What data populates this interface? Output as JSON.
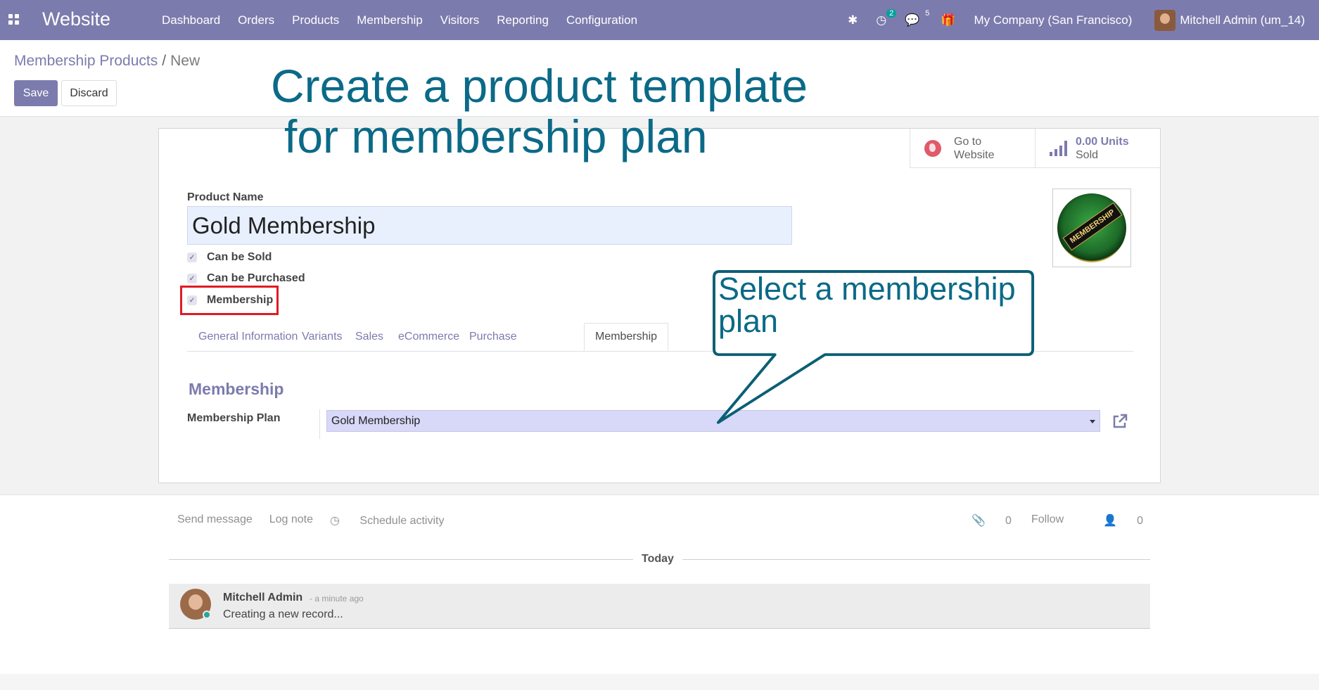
{
  "navbar": {
    "app_name": "Website",
    "menu": [
      "Dashboard",
      "Orders",
      "Products",
      "Membership",
      "Visitors",
      "Reporting",
      "Configuration"
    ],
    "activity_count": "2",
    "message_count": "5",
    "company": "My Company (San Francisco)",
    "user": "Mitchell Admin (um_14)"
  },
  "breadcrumb": {
    "parent": "Membership Products",
    "separator": "/",
    "current": "New"
  },
  "buttons": {
    "save": "Save",
    "discard": "Discard"
  },
  "smart_buttons": {
    "website": {
      "line1": "Go to",
      "line2": "Website"
    },
    "sold": {
      "line1": "0.00 Units",
      "line2": "Sold"
    }
  },
  "form": {
    "product_name_label": "Product Name",
    "product_name": "Gold Membership",
    "checkboxes": [
      {
        "label": "Can be Sold",
        "checked": true
      },
      {
        "label": "Can be Purchased",
        "checked": true
      },
      {
        "label": "Membership",
        "checked": true
      }
    ],
    "image_text": "MEMBERSHIP",
    "tabs": [
      "General Information",
      "Variants",
      "Sales",
      "eCommerce",
      "Purchase",
      "Membership"
    ],
    "active_tab": "Membership",
    "section_title": "Membership",
    "membership_plan_label": "Membership Plan",
    "membership_plan": "Gold Membership"
  },
  "chatter": {
    "actions": [
      "Send message",
      "Log note",
      "Schedule activity"
    ],
    "attachments": "0",
    "follow": "Follow",
    "followers": "0",
    "date_separator": "Today",
    "message": {
      "author": "Mitchell Admin",
      "time": "- a minute ago",
      "body": "Creating a new record..."
    }
  },
  "annotations": {
    "title_line1": "Create a product template",
    "title_line2": "for membership plan",
    "callout": "Select a membership plan"
  },
  "colors": {
    "brand": "#7c7bad",
    "annotation": "#0b6a87",
    "highlight": "#e01b24"
  }
}
